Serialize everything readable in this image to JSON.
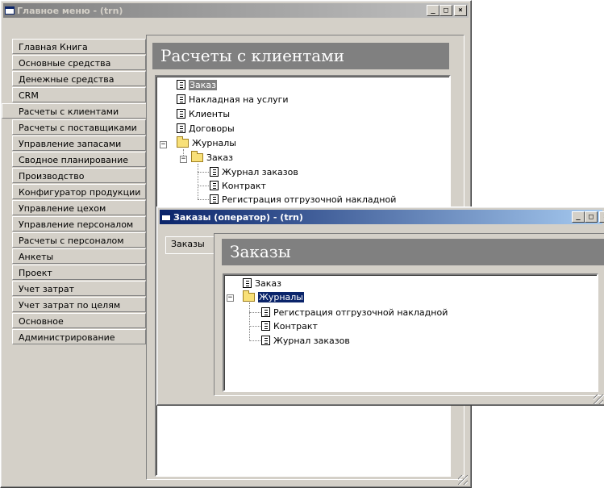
{
  "main_window": {
    "title": "Главное меню  -  (trn)",
    "nav_items": [
      "Главная Книга",
      "Основные средства",
      "Денежные средства",
      "CRM",
      "Расчеты с клиентами",
      "Расчеты с поставщиками",
      "Управление запасами",
      "Сводное планирование",
      "Производство",
      "Конфигуратор продукции",
      "Управление цехом",
      "Управление персоналом",
      "Расчеты с персоналом",
      "Анкеты",
      "Проект",
      "Учет затрат",
      "Учет затрат по целям",
      "Основное",
      "Администрирование"
    ],
    "selected_nav": "Расчеты с клиентами",
    "banner": "Расчеты с клиентами",
    "tree": {
      "zakaz": "Заказ",
      "nakladnaya": "Накладная на услуги",
      "klienty": "Клиенты",
      "dogovory": "Договоры",
      "zhurnaly": "Журналы",
      "zakaz_folder": "Заказ",
      "zhurnal_zakazov": "Журнал заказов",
      "kontrakt": "Контракт",
      "registraciya": "Регистрация отгрузочной накладной"
    }
  },
  "orders_window": {
    "title": "Заказы (оператор)  -  (trn)",
    "tab": "Заказы",
    "banner": "Заказы",
    "tree": {
      "zakaz": "Заказ",
      "zhurnaly": "Журналы",
      "registraciya": "Регистрация отгрузочной накладной",
      "kontrakt": "Контракт",
      "zhurnal_zakazov": "Журнал заказов"
    }
  },
  "controls": {
    "minimize": "_",
    "maximize": "□",
    "close": "×"
  },
  "colors": {
    "face": "#d4d0c8",
    "active_title": "#0a246a",
    "inactive_title": "#808080",
    "banner": "#808080"
  }
}
